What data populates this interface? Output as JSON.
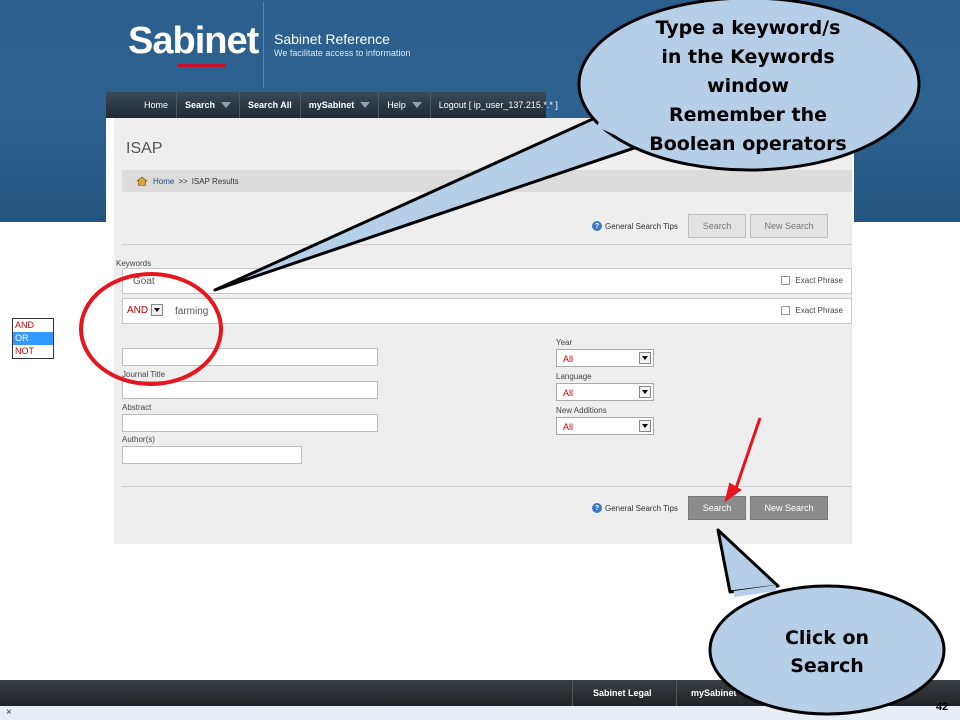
{
  "header": {
    "logo": "Sabinet",
    "title": "Sabinet Reference",
    "tagline": "We facilitate access to information"
  },
  "nav": {
    "home": "Home",
    "search": "Search",
    "search_all": "Search All",
    "mysabinet": "mySabinet",
    "help": "Help",
    "logout": "Logout  [ ip_user_137.215.*.* ]"
  },
  "page": {
    "title": "ISAP",
    "breadcrumb_home": "Home",
    "breadcrumb_sep": ">>",
    "breadcrumb_current": "ISAP Results"
  },
  "search": {
    "tips_label": "General Search Tips",
    "search_button": "Search",
    "new_search_button": "New Search",
    "keywords_label": "Keywords",
    "keyword1_value": "Goat",
    "keyword2_value": "farming",
    "exact_phrase_label": "Exact Phrase",
    "operator_selected": "AND",
    "operator_options": [
      "AND",
      "OR",
      "NOT"
    ],
    "journal_title_label": "Journal Title",
    "abstract_label": "Abstract",
    "authors_label": "Author(s)",
    "year_label": "Year",
    "year_value": "All",
    "language_label": "Language",
    "language_value": "All",
    "new_additions_label": "New Additions",
    "new_additions_value": "All"
  },
  "footer": {
    "legal": "Sabinet Legal",
    "mysabinet": "mySabinet",
    "close": "×",
    "slide_number": "42"
  },
  "callouts": {
    "keyword_tip_lines": [
      "Type a keyword/s",
      "in the Keywords",
      "window",
      "Remember the",
      "Boolean operators"
    ],
    "search_tip_lines": [
      "Click on",
      "Search"
    ]
  },
  "colors": {
    "header_blue": "#2b5f8d",
    "callout_fill": "#b5cfe8",
    "highlight_red": "#e8141e",
    "operator_red": "#cc0000"
  }
}
